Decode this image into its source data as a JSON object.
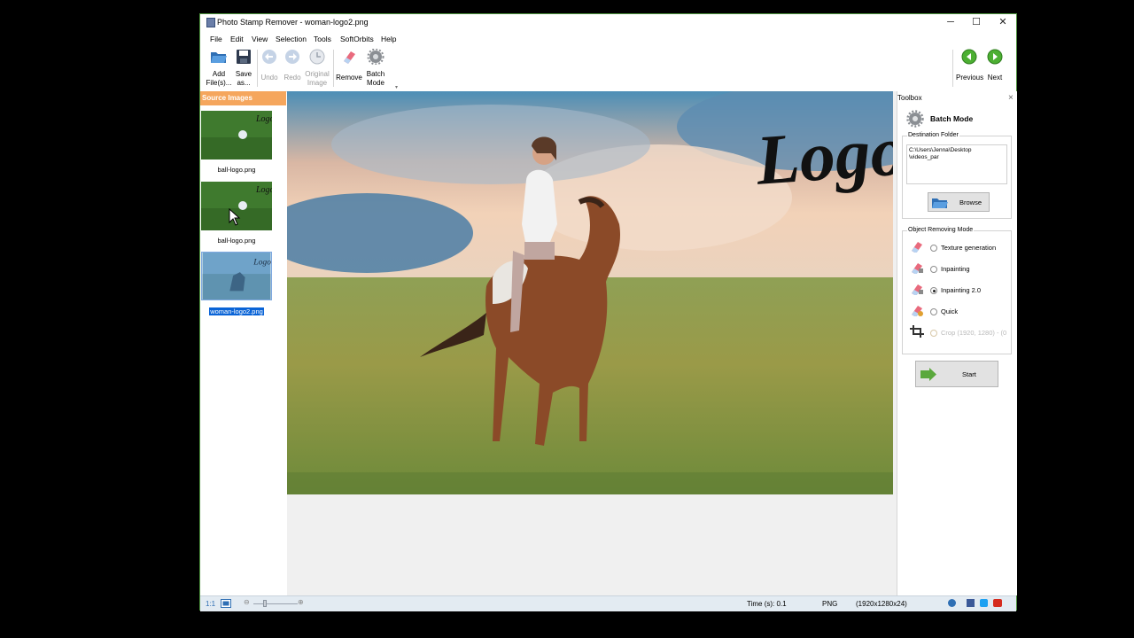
{
  "window": {
    "title": "Photo Stamp Remover - woman-logo2.png"
  },
  "window_controls": {
    "minimize": "─",
    "maximize": "☐",
    "close": "✕"
  },
  "menu": [
    "File",
    "Edit",
    "View",
    "Selection",
    "Tools",
    "SoftOrbits",
    "Help"
  ],
  "toolbar": {
    "add_files": [
      "Add",
      "File(s)..."
    ],
    "save_as": [
      "Save",
      "as..."
    ],
    "undo": "Undo",
    "redo": "Redo",
    "original_image": [
      "Original",
      "Image"
    ],
    "remove": "Remove",
    "batch_mode": [
      "Batch",
      "Mode"
    ],
    "previous": "Previous",
    "next": "Next"
  },
  "source_images": {
    "header": "Source Images",
    "items": [
      {
        "label": "ball-logo.png",
        "selected": false
      },
      {
        "label": "ball-logo.png",
        "selected": false
      },
      {
        "label": "woman-logo2.png",
        "selected": true
      }
    ]
  },
  "photo": {
    "logo_text": "Logo."
  },
  "toolbox": {
    "header": "Toolbox",
    "close": "×",
    "batch_mode_title": "Batch Mode",
    "destination_folder_label": "Destination Folder",
    "destination_path_line1": "C:\\Users\\Jenna\\Desktop",
    "destination_path_line2": "\\videos_par",
    "browse_button": "Browse",
    "mode_group_label": "Object Removing Mode",
    "modes": [
      {
        "label": "Texture generation",
        "checked": false,
        "enabled": true
      },
      {
        "label": "Inpainting",
        "checked": false,
        "enabled": true
      },
      {
        "label": "Inpainting 2.0",
        "checked": true,
        "enabled": true
      },
      {
        "label": "Quick",
        "checked": false,
        "enabled": true
      },
      {
        "label": "Crop (1920, 1280) - (0",
        "checked": false,
        "enabled": false
      }
    ],
    "start_button": "Start"
  },
  "statusbar": {
    "zoom_label": "1:1",
    "time": "Time (s): 0.1",
    "format": "PNG",
    "dimensions": "(1920x1280x24)"
  },
  "colors": {
    "selection": "#0a64d7",
    "header_orange": "#f5a65d",
    "nav_green": "#4caf32",
    "statusbar_bg": "#e3ebf2"
  }
}
